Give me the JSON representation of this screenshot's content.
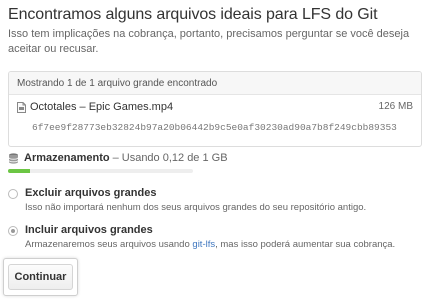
{
  "header": {
    "title": "Encontramos alguns arquivos ideais para LFS do Git",
    "description": "Isso tem implicações na cobrança, portanto, precisamos perguntar se você deseja aceitar ou recusar."
  },
  "files_box": {
    "header": "Mostrando 1 de 1 arquivo grande encontrado",
    "files": [
      {
        "icon": "file-icon",
        "name": "Octotales – Epic Games.mp4",
        "size": "126 MB",
        "oid": "6f7ee9f28773eb32824b97a20b06442b9c5e0af30230ad90a7b8f249cbb89353"
      }
    ]
  },
  "storage": {
    "icon": "database-icon",
    "label": "Armazenamento",
    "usage": "– Usando 0,12 de 1 GB",
    "used_fraction": 0.12,
    "bar_color": "#6cc644"
  },
  "options": [
    {
      "title": "Excluir arquivos grandes",
      "description": "Isso não importará nenhum dos seus arquivos grandes do seu repositório antigo.",
      "checked": false
    },
    {
      "title": "Incluir arquivos grandes",
      "description_before": "Armazenaremos seus arquivos usando ",
      "link": "git-lfs",
      "description_after": ", mas isso poderá aumentar sua cobrança.",
      "checked": true
    }
  ],
  "actions": {
    "continue_label": "Continuar"
  },
  "colors": {
    "link": "#4078c0",
    "text": "#333333",
    "muted": "#666666"
  }
}
